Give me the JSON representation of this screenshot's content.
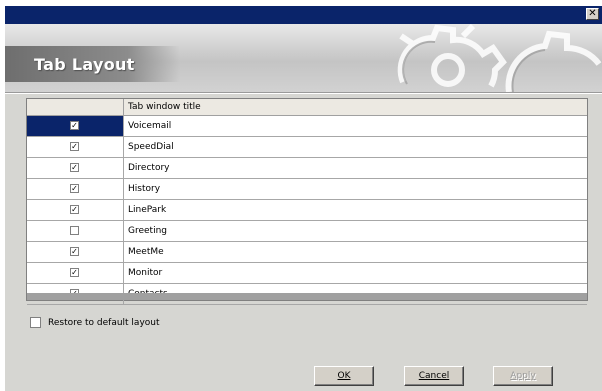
{
  "window": {
    "close_glyph": "✕"
  },
  "banner": {
    "title": "Tab Layout",
    "icon": "gears-icon"
  },
  "table": {
    "header_check": "",
    "header_title": "Tab window title",
    "rows": [
      {
        "title": "Voicemail",
        "checked": true,
        "selected": true
      },
      {
        "title": "SpeedDial",
        "checked": true,
        "selected": false
      },
      {
        "title": "Directory",
        "checked": true,
        "selected": false
      },
      {
        "title": "History",
        "checked": true,
        "selected": false
      },
      {
        "title": "LinePark",
        "checked": true,
        "selected": false
      },
      {
        "title": "Greeting",
        "checked": false,
        "selected": false
      },
      {
        "title": "MeetMe",
        "checked": true,
        "selected": false
      },
      {
        "title": "Monitor",
        "checked": true,
        "selected": false
      },
      {
        "title": "Contacts",
        "checked": true,
        "selected": false
      }
    ]
  },
  "restore": {
    "label": "Restore to default layout",
    "checked": false
  },
  "buttons": {
    "ok": "OK",
    "cancel": "Cancel",
    "apply": "Apply"
  },
  "colors": {
    "titlebar": "#0a246a",
    "selected_cell": "#0a246a",
    "dialog_bg": "#d6d6d2"
  }
}
